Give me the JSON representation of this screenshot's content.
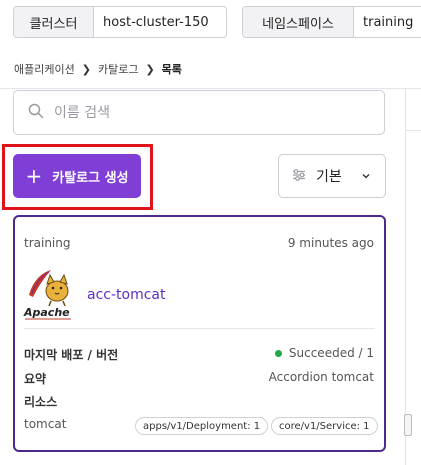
{
  "top_bar": {
    "cluster_label": "클러스터",
    "cluster_value": "host-cluster-150",
    "namespace_label": "네임스페이스",
    "namespace_value": "training"
  },
  "breadcrumb": {
    "items": [
      "애플리케이션",
      "카탈로그",
      "목록"
    ]
  },
  "search": {
    "placeholder": "이름 검색",
    "value": ""
  },
  "create_button": {
    "label": "카탈로그 생성"
  },
  "sort": {
    "selected": "기본"
  },
  "card": {
    "namespace": "training",
    "time": "9 minutes ago",
    "logo_text": "Apache",
    "app_name": "acc-tomcat",
    "last_deploy_label": "마지막 배포 / 버전",
    "last_deploy_value": "Succeeded / 1",
    "summary_label": "요약",
    "summary_value": "Accordion tomcat",
    "resources_label": "리소스",
    "resource_name": "tomcat",
    "resource_tags": [
      "apps/v1/Deployment: 1",
      "core/v1/Service: 1"
    ],
    "status_color": "#22a84a"
  },
  "colors": {
    "accent": "#7f3fd6",
    "card_border": "#4b2a8a",
    "highlight": "#e0131a",
    "link": "#5b2ec2"
  }
}
